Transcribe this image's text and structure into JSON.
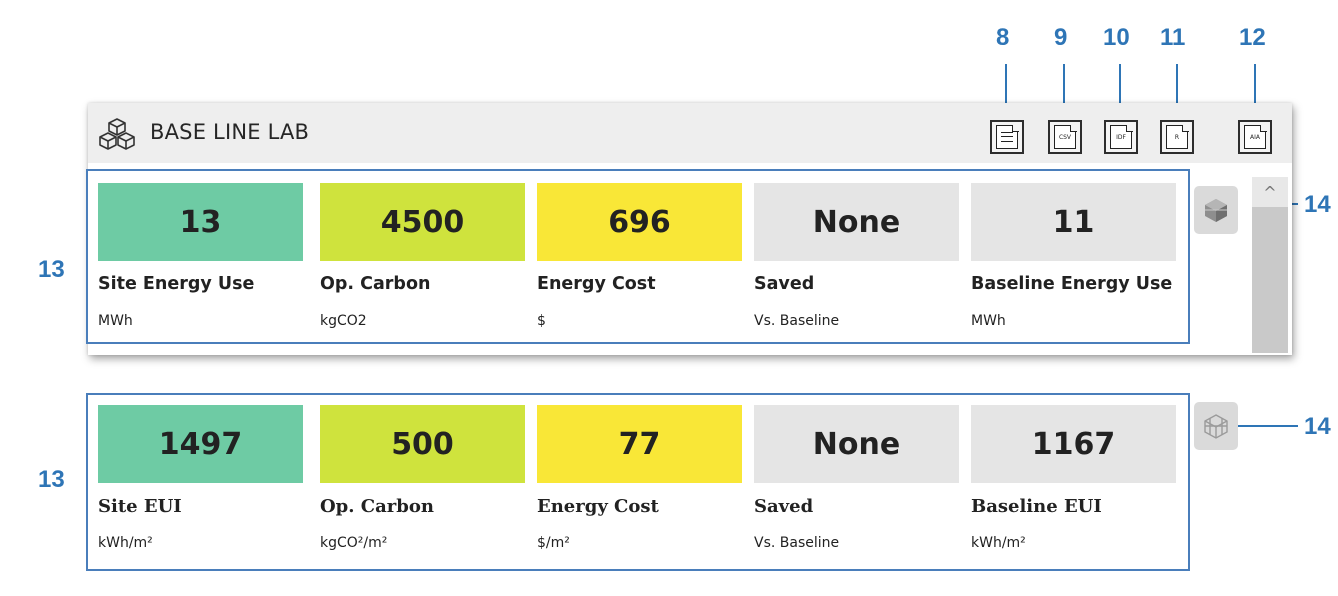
{
  "callouts": {
    "export_report": "8",
    "export_csv": "9",
    "export_idf": "10",
    "export_r": "11",
    "export_aia": "12",
    "metrics_group_top": "13",
    "metrics_group_bottom": "13",
    "view_toggle_top": "14",
    "view_toggle_bottom": "14"
  },
  "panel": {
    "title": "BASE LINE LAB",
    "buttons": [
      {
        "id": "report",
        "label": "",
        "icon": "report-icon"
      },
      {
        "id": "csv",
        "label": "CSV",
        "icon": "csv-file-icon"
      },
      {
        "id": "idf",
        "label": "IDF",
        "icon": "idf-file-icon"
      },
      {
        "id": "r",
        "label": "R",
        "icon": "r-file-icon"
      },
      {
        "id": "aia",
        "label": "AIA",
        "icon": "aia-file-icon"
      }
    ],
    "scroll_up_glyph": "^"
  },
  "colors": {
    "site": "#6ecba4",
    "carbon": "#cfe33d",
    "cost": "#f9e737",
    "saved": "#e5e5e5",
    "baseline": "#e5e5e5",
    "callout": "#2e75b6"
  },
  "metrics_top": [
    {
      "value": "13",
      "label": "Site Energy Use",
      "unit": "MWh"
    },
    {
      "value": "4500",
      "label": "Op. Carbon",
      "unit": "kgCO2"
    },
    {
      "value": "696",
      "label": "Energy Cost",
      "unit": "$"
    },
    {
      "value": "None",
      "label": "Saved",
      "unit": "Vs. Baseline"
    },
    {
      "value": "11",
      "label": "Baseline Energy Use",
      "unit": "MWh"
    }
  ],
  "metrics_bottom": [
    {
      "value": "1497",
      "label": "Site EUI",
      "unit": "kWh/m²"
    },
    {
      "value": "500",
      "label": "Op. Carbon",
      "unit": "kgCO²/m²"
    },
    {
      "value": "77",
      "label": "Energy Cost",
      "unit": "$/m²"
    },
    {
      "value": "None",
      "label": "Saved",
      "unit": "Vs. Baseline"
    },
    {
      "value": "1167",
      "label": "Baseline EUI",
      "unit": "kWh/m²"
    }
  ]
}
